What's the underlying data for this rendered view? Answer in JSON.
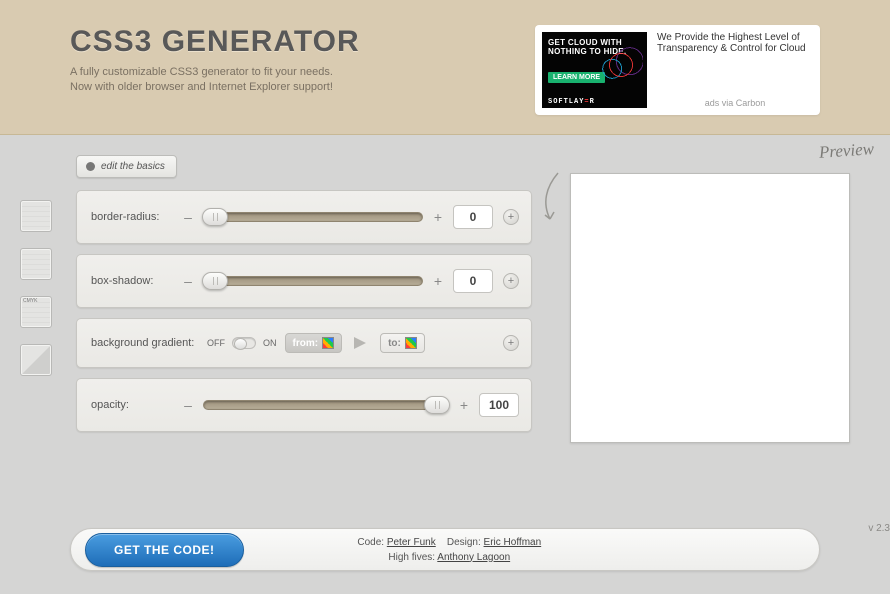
{
  "header": {
    "title": "CSS3 GENERATOR",
    "tagline_line1": "A fully customizable CSS3 generator to fit your needs.",
    "tagline_line2": "Now with older browser and Internet Explorer support!"
  },
  "ad": {
    "headline": "GET CLOUD WITH NOTHING TO HIDE.",
    "cta": "LEARN MORE",
    "logo_prefix": "SOFTLAY",
    "logo_accent": "=",
    "logo_suffix": "R",
    "copy": "We Provide the Highest Level of Transparency & Control for Cloud",
    "via": "ads via Carbon"
  },
  "edit_basics_label": "edit the basics",
  "rows": {
    "border_radius": {
      "label": "border-radius:",
      "value": "0"
    },
    "box_shadow": {
      "label": "box-shadow:",
      "value": "0"
    },
    "gradient": {
      "label": "background gradient:",
      "off": "OFF",
      "on": "ON",
      "from": "from:",
      "to": "to:"
    },
    "opacity": {
      "label": "opacity:",
      "value": "100"
    }
  },
  "signs": {
    "minus": "–",
    "plus": "+",
    "expand": "+"
  },
  "preview": {
    "label": "Preview"
  },
  "version": "v 2.3",
  "footer": {
    "cta": "GET THE CODE!",
    "code_label": "Code:",
    "code_name": "Peter Funk",
    "design_label": "Design:",
    "design_name": "Eric Hoffman",
    "highfives_label": "High fives:",
    "highfives_name": "Anthony Lagoon"
  }
}
